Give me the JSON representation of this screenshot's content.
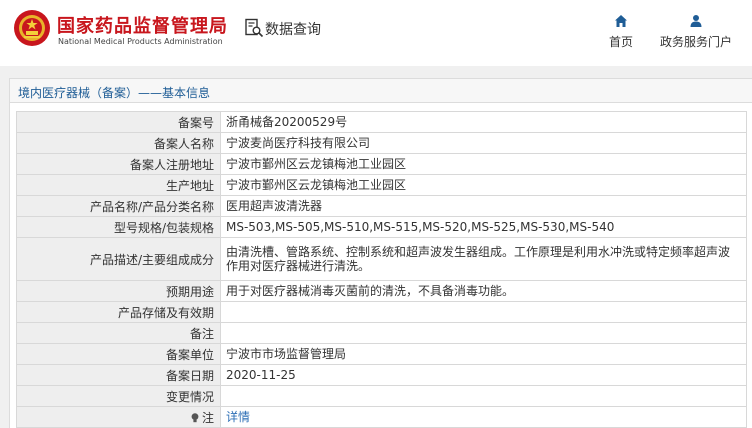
{
  "header": {
    "logo_cn": "国家药品监督管理局",
    "logo_en": "National Medical Products Administration",
    "query_label": "数据查询",
    "nav": [
      {
        "label": "首页",
        "icon": "home-icon"
      },
      {
        "label": "政务服务门户",
        "icon": "user-icon"
      }
    ]
  },
  "breadcrumb": "境内医疗器械（备案）——基本信息",
  "rows": [
    {
      "label": "备案号",
      "value": "浙甬械备20200529号"
    },
    {
      "label": "备案人名称",
      "value": "宁波麦尚医疗科技有限公司"
    },
    {
      "label": "备案人注册地址",
      "value": "宁波市鄞州区云龙镇梅池工业园区"
    },
    {
      "label": "生产地址",
      "value": "宁波市鄞州区云龙镇梅池工业园区"
    },
    {
      "label": "产品名称/产品分类名称",
      "value": "医用超声波清洗器"
    },
    {
      "label": "型号规格/包装规格",
      "value": "MS-503,MS-505,MS-510,MS-515,MS-520,MS-525,MS-530,MS-540"
    },
    {
      "label": "产品描述/主要组成成分",
      "value": "由清洗槽、管路系统、控制系统和超声波发生器组成。工作原理是利用水冲洗或特定频率超声波作用对医疗器械进行清洗。"
    },
    {
      "label": "预期用途",
      "value": "用于对医疗器械消毒灭菌前的清洗，不具备消毒功能。"
    },
    {
      "label": "产品存储及有效期",
      "value": ""
    },
    {
      "label": "备注",
      "value": ""
    },
    {
      "label": "备案单位",
      "value": "宁波市市场监督管理局"
    },
    {
      "label": "备案日期",
      "value": "2020-11-25"
    },
    {
      "label": "变更情况",
      "value": ""
    },
    {
      "label": "注",
      "value": "详情"
    }
  ],
  "colors": {
    "brand_red": "#c8161d",
    "nav_blue": "#1f5d96",
    "link_blue": "#2d6fb6",
    "label_bg": "#eeeeee"
  }
}
